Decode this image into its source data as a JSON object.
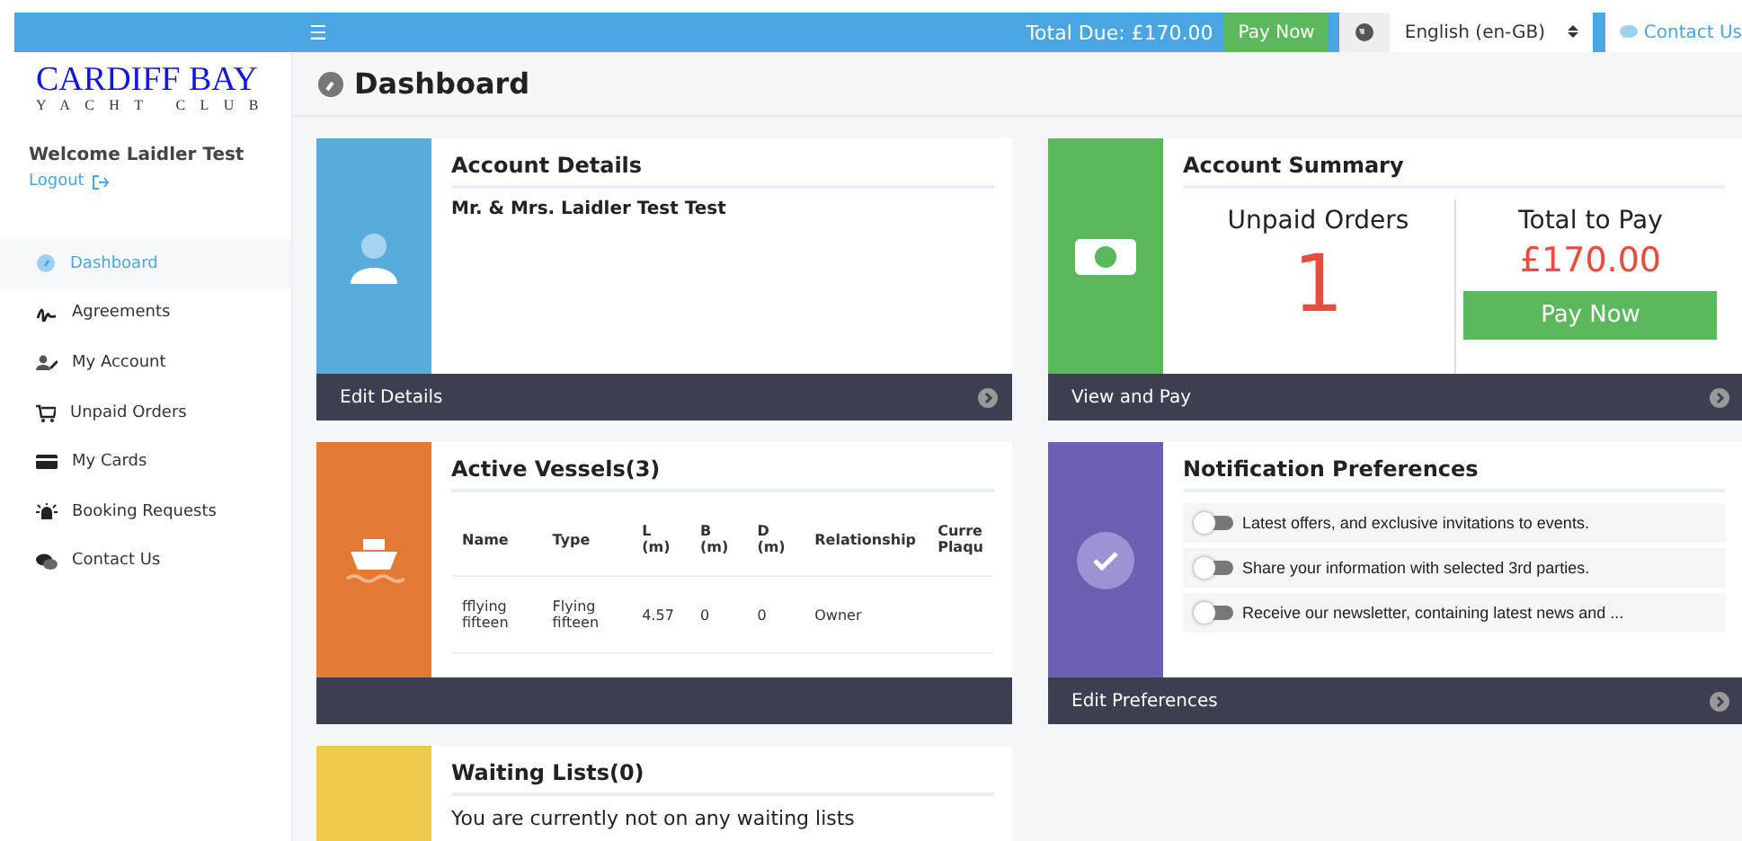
{
  "topbar": {
    "menu_glyph": "☰",
    "total_due": "Total Due: £170.00",
    "pay_button": "Pay Now",
    "language": "English (en-GB)",
    "contact": "Contact Us"
  },
  "sidebar": {
    "logo_title": "CARDIFF BAY",
    "logo_subtitle": "YACHT CLUB",
    "welcome": "Welcome Laidler Test",
    "logout": "Logout",
    "items": [
      {
        "label": "Dashboard",
        "selected": true
      },
      {
        "label": "Agreements",
        "selected": false
      },
      {
        "label": "My Account",
        "selected": false
      },
      {
        "label": "Unpaid Orders",
        "selected": false
      },
      {
        "label": "My Cards",
        "selected": false
      },
      {
        "label": "Booking Requests",
        "selected": false
      },
      {
        "label": "Contact Us",
        "selected": false
      }
    ]
  },
  "page_title": "Dashboard",
  "account_details": {
    "title": "Account Details",
    "name": "Mr. & Mrs. Laidler Test Test",
    "footer": "Edit Details"
  },
  "account_summary": {
    "title": "Account Summary",
    "unpaid_label": "Unpaid Orders",
    "unpaid_count": "1",
    "total_label": "Total to Pay",
    "total": "£170.00",
    "pay_button": "Pay Now",
    "footer": "View and Pay"
  },
  "active_vessels": {
    "title": "Active Vessels(3)",
    "columns": [
      "Name",
      "Type",
      "L (m)",
      "B (m)",
      "D (m)",
      "Relationship",
      "Curre Plaqu"
    ],
    "rows": [
      [
        "fflying fifteen",
        "Flying fifteen",
        "4.57",
        "0",
        "0",
        "Owner",
        ""
      ]
    ]
  },
  "notifications": {
    "title": "Notification Preferences",
    "footer": "Edit Preferences",
    "items": [
      {
        "label": "Latest offers, and exclusive invitations to events.",
        "on": false
      },
      {
        "label": "Share your information with selected 3rd parties.",
        "on": false
      },
      {
        "label": "Receive our newsletter, containing latest news and ...",
        "on": false
      }
    ]
  },
  "waiting_lists": {
    "title": "Waiting Lists(0)",
    "message": "You are currently not on any waiting lists"
  }
}
